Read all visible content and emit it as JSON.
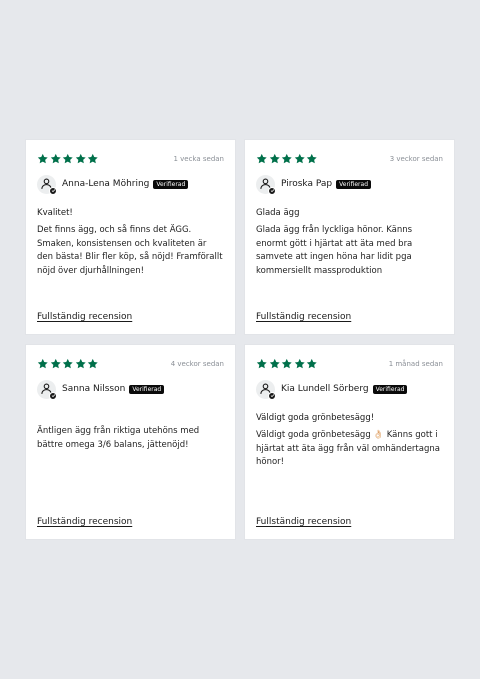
{
  "colors": {
    "star": "#00704a",
    "badge_bg": "#0a0a0a",
    "page_bg": "#e6e8ec"
  },
  "link_label": "Fullständig recension",
  "reviews": [
    {
      "stars": 5,
      "date": "1 vecka sedan",
      "name": "Anna-Lena Möhring",
      "badge": "Verifierad",
      "title": "Kvalitet!",
      "body": "Det finns ägg, och så finns det ÄGG. Smaken, konsistensen och kvaliteten är den bästa! Blir fler köp, så nöjd! Framförallt nöjd över djurhållningen!"
    },
    {
      "stars": 5,
      "date": "3 veckor sedan",
      "name": "Piroska Pap",
      "badge": "Verifierad",
      "title": "Glada ägg",
      "body": "Glada ägg från lyckliga hönor. Känns enormt gött i hjärtat att äta med bra samvete att ingen höna har lidit pga kommersiellt massproduktion"
    },
    {
      "stars": 5,
      "date": "4 veckor sedan",
      "name": "Sanna Nilsson",
      "badge": "Verifierad",
      "title": "",
      "body": "Äntligen ägg från riktiga utehöns med bättre omega 3/6 balans, jättenöjd!"
    },
    {
      "stars": 5,
      "date": "1 månad sedan",
      "name": "Kia Lundell Sörberg",
      "badge": "Verifierad",
      "title": "Väldigt goda grönbetesägg!",
      "body": "Väldigt goda grönbetesägg 👌🏻 Känns gott i hjärtat att äta ägg från väl omhändertagna hönor!"
    }
  ]
}
